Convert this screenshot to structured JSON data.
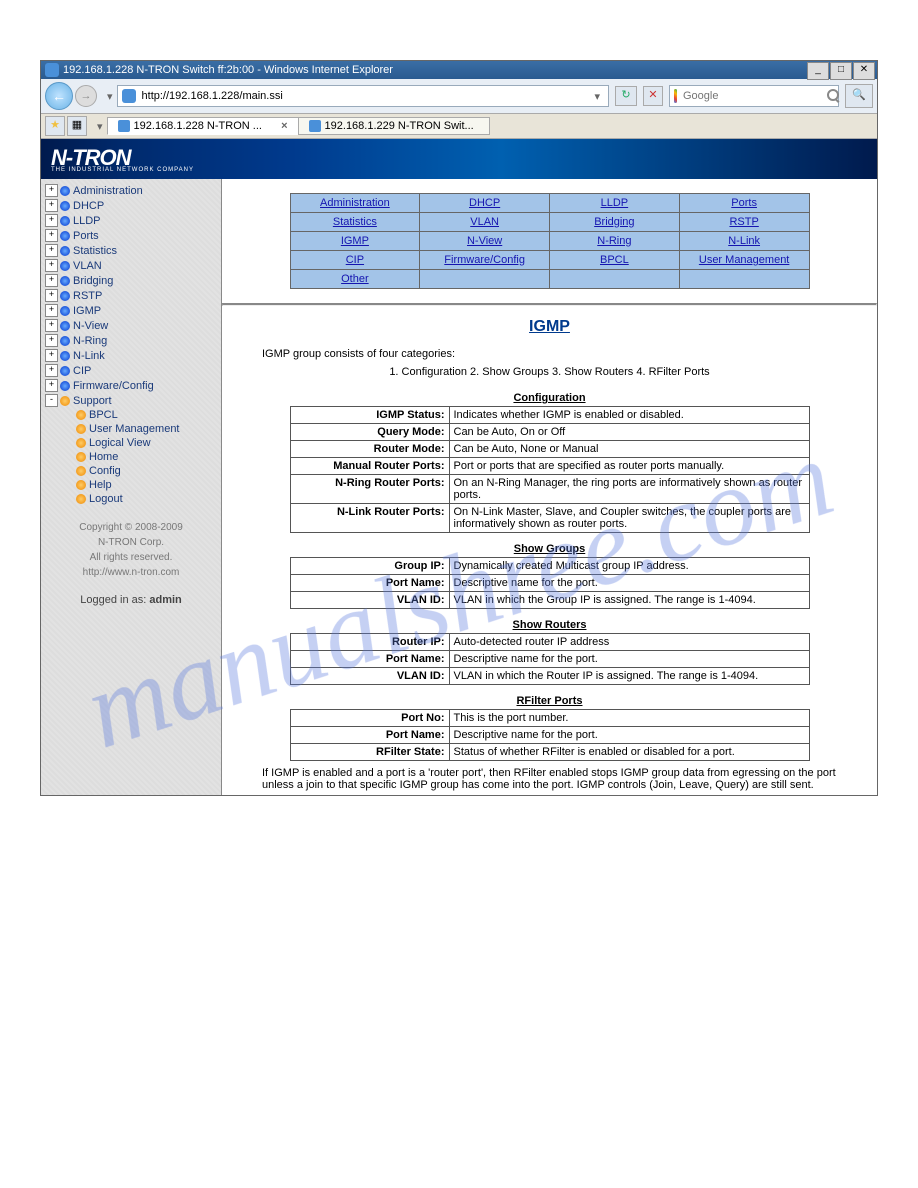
{
  "window": {
    "title": "192.168.1.228 N-TRON Switch ff:2b:00 - Windows Internet Explorer"
  },
  "address_bar": {
    "url": "http://192.168.1.228/main.ssi"
  },
  "search": {
    "placeholder": "Google"
  },
  "tabs": [
    {
      "label": "192.168.1.228 N-TRON ...",
      "active": true
    },
    {
      "label": "192.168.1.229 N-TRON Swit...",
      "active": false
    }
  ],
  "logo": {
    "text": "N-TRON",
    "sub": "THE INDUSTRIAL NETWORK COMPANY"
  },
  "sidebar": {
    "items": [
      {
        "label": "Administration",
        "bullet": "blue",
        "expander": "+"
      },
      {
        "label": "DHCP",
        "bullet": "blue",
        "expander": "+"
      },
      {
        "label": "LLDP",
        "bullet": "blue",
        "expander": "+"
      },
      {
        "label": "Ports",
        "bullet": "blue",
        "expander": "+"
      },
      {
        "label": "Statistics",
        "bullet": "blue",
        "expander": "+"
      },
      {
        "label": "VLAN",
        "bullet": "blue",
        "expander": "+"
      },
      {
        "label": "Bridging",
        "bullet": "blue",
        "expander": "+"
      },
      {
        "label": "RSTP",
        "bullet": "blue",
        "expander": "+"
      },
      {
        "label": "IGMP",
        "bullet": "blue",
        "expander": "+"
      },
      {
        "label": "N-View",
        "bullet": "blue",
        "expander": "+"
      },
      {
        "label": "N-Ring",
        "bullet": "blue",
        "expander": "+"
      },
      {
        "label": "N-Link",
        "bullet": "blue",
        "expander": "+"
      },
      {
        "label": "CIP",
        "bullet": "blue",
        "expander": "+"
      },
      {
        "label": "Firmware/Config",
        "bullet": "blue",
        "expander": "+"
      },
      {
        "label": "Support",
        "bullet": "orange",
        "expander": "-"
      },
      {
        "label": "BPCL",
        "bullet": "orange",
        "expander": "blank",
        "indent": true
      },
      {
        "label": "User Management",
        "bullet": "orange",
        "expander": "blank",
        "indent": true
      },
      {
        "label": "Logical View",
        "bullet": "orange",
        "expander": "blank",
        "indent": true
      },
      {
        "label": "Home",
        "bullet": "orange",
        "expander": "blank",
        "indent": true
      },
      {
        "label": "Config",
        "bullet": "orange",
        "expander": "blank",
        "indent": true
      },
      {
        "label": "Help",
        "bullet": "orange",
        "expander": "blank",
        "indent": true
      },
      {
        "label": "Logout",
        "bullet": "orange",
        "expander": "blank",
        "indent": true
      }
    ],
    "copyright_l1": "Copyright © 2008-2009",
    "copyright_l2": "N-TRON Corp.",
    "copyright_l3": "All rights reserved.",
    "copyright_url": "http://www.n-tron.com",
    "loggedin_pre": "Logged in as: ",
    "loggedin_user": "admin"
  },
  "nav_table": [
    [
      "Administration",
      "DHCP",
      "LLDP",
      "Ports"
    ],
    [
      "Statistics",
      "VLAN",
      "Bridging",
      "RSTP"
    ],
    [
      "IGMP",
      "N-View",
      "N-Ring",
      "N-Link"
    ],
    [
      "CIP",
      "Firmware/Config",
      "BPCL",
      "User Management"
    ],
    [
      "Other",
      "",
      "",
      ""
    ]
  ],
  "page": {
    "title": "IGMP",
    "intro": "IGMP group consists of four categories:",
    "cats": "1. Configuration   2. Show Groups   3. Show Routers   4. RFilter Ports",
    "sections": [
      {
        "heading": "Configuration",
        "rows": [
          {
            "k": "IGMP Status:",
            "v": "Indicates whether IGMP is enabled or disabled."
          },
          {
            "k": "Query Mode:",
            "v": "Can be Auto, On or Off"
          },
          {
            "k": "Router Mode:",
            "v": "Can be Auto, None or Manual"
          },
          {
            "k": "Manual Router Ports:",
            "v": "Port or ports that are specified as router ports manually."
          },
          {
            "k": "N-Ring Router Ports:",
            "v": "On an N-Ring Manager, the ring ports are informatively shown as router ports."
          },
          {
            "k": "N-Link Router Ports:",
            "v": "On N-Link Master, Slave, and Coupler switches, the coupler ports are informatively shown as router ports."
          }
        ]
      },
      {
        "heading": "Show Groups",
        "rows": [
          {
            "k": "Group IP:",
            "v": "Dynamically created Multicast group IP address."
          },
          {
            "k": "Port Name:",
            "v": "Descriptive name for the port."
          },
          {
            "k": "VLAN ID:",
            "v": "VLAN in which the Group IP is assigned. The range is 1-4094."
          }
        ]
      },
      {
        "heading": "Show Routers",
        "rows": [
          {
            "k": "Router IP:",
            "v": "Auto-detected router IP address"
          },
          {
            "k": "Port Name:",
            "v": "Descriptive name for the port."
          },
          {
            "k": "VLAN ID:",
            "v": "VLAN in which the Router IP is assigned. The range is 1-4094."
          }
        ]
      },
      {
        "heading": "RFilter Ports",
        "rows": [
          {
            "k": "Port No:",
            "v": "This is the port number."
          },
          {
            "k": "Port Name:",
            "v": "Descriptive name for the port."
          },
          {
            "k": "RFilter State:",
            "v": "Status of whether RFilter is enabled or disabled for a port."
          }
        ]
      }
    ],
    "note": "If IGMP is enabled and a port is a 'router port', then RFilter enabled stops IGMP group data from egressing on the port unless a join to that specific IGMP group has come into the port. IGMP controls (Join, Leave, Query) are still sent."
  },
  "watermark": "manualshree.com"
}
